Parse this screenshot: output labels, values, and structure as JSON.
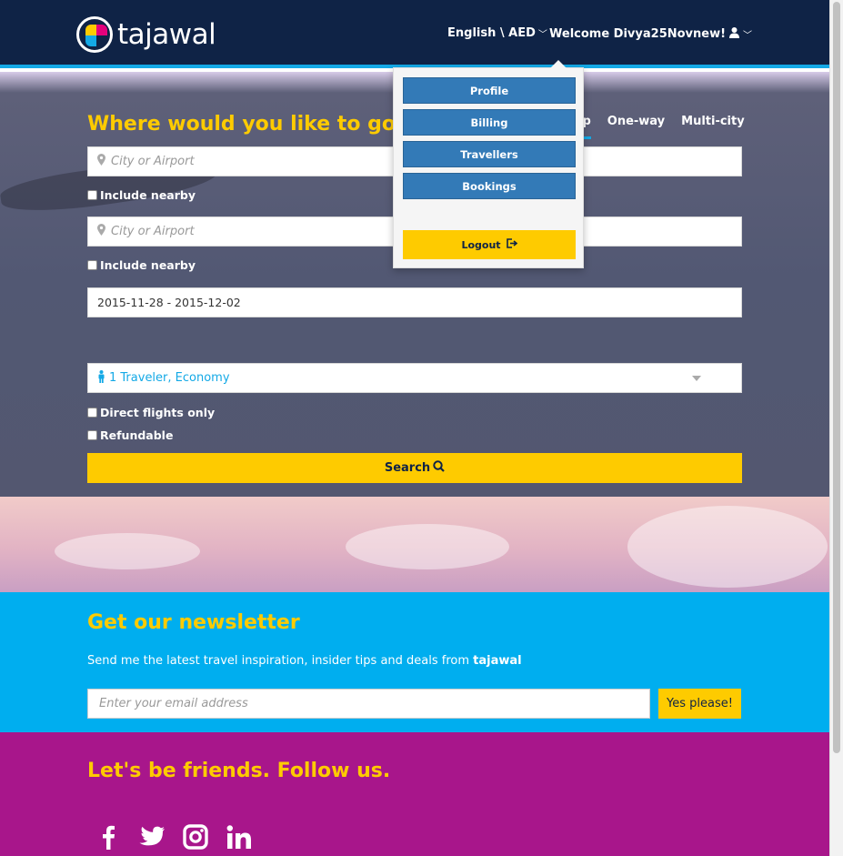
{
  "header": {
    "logo_text": "tajawal",
    "language_currency": "English \\ AED",
    "welcome_text": "Welcome Divya25Novnew!"
  },
  "search": {
    "title": "Where would you like to go?",
    "tabs": [
      {
        "label": "ip",
        "active": true
      },
      {
        "label": "One-way",
        "active": false
      },
      {
        "label": "Multi-city",
        "active": false
      }
    ],
    "origin_placeholder": "City or Airport",
    "origin_nearby_label": "Include nearby",
    "destination_placeholder": "City or Airport",
    "destination_nearby_label": "Include nearby",
    "date_range": "2015-11-28 - 2015-12-02",
    "travelers": "1 Traveler, Economy",
    "direct_flights_label": "Direct flights only",
    "refundable_label": "Refundable",
    "search_button": "Search"
  },
  "user_menu": {
    "items": [
      "Profile",
      "Billing",
      "Travellers",
      "Bookings"
    ],
    "logout_label": "Logout"
  },
  "newsletter": {
    "title": "Get our newsletter",
    "description": "Send me the latest travel inspiration, insider tips and deals from",
    "brand": "tajawal",
    "email_placeholder": "Enter your email address",
    "submit_label": "Yes please!"
  },
  "social": {
    "title": "Let's be friends. Follow us.",
    "icons": [
      "facebook-icon",
      "twitter-icon",
      "instagram-icon",
      "linkedin-icon"
    ]
  },
  "colors": {
    "header_bg": "#0f2346",
    "accent_yellow": "#fecb00",
    "accent_blue": "#14a9e6",
    "newsletter_bg": "#00aeef",
    "social_bg": "#a8168b",
    "menu_button": "#337ab7"
  }
}
